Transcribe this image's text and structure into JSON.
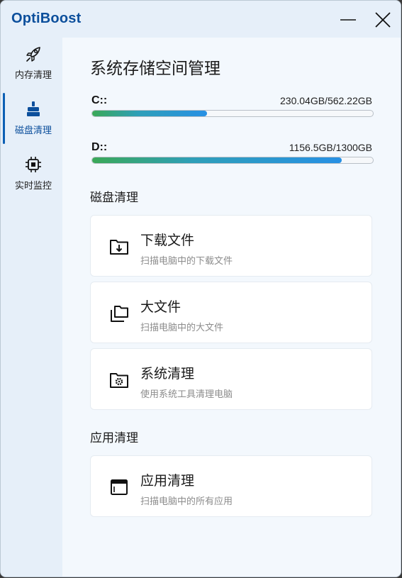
{
  "app": {
    "title": "OptiBoost"
  },
  "window_controls": {
    "minimize_icon": "minimize-icon",
    "close_icon": "close-icon"
  },
  "sidebar": {
    "items": [
      {
        "label": "内存清理",
        "icon": "rocket-icon",
        "active": false
      },
      {
        "label": "磁盘清理",
        "icon": "broom-icon",
        "active": true
      },
      {
        "label": "实时监控",
        "icon": "chip-icon",
        "active": false
      }
    ]
  },
  "main": {
    "title": "系统存储空间管理",
    "disks": [
      {
        "name": "C::",
        "usage": "230.04GB/562.22GB",
        "used_fraction": 0.4092
      },
      {
        "name": "D::",
        "usage": "1156.5GB/1300GB",
        "used_fraction": 0.8896
      }
    ],
    "disk_section": {
      "title": "磁盘清理",
      "cards": [
        {
          "title": "下载文件",
          "desc": "扫描电脑中的下载文件",
          "icon": "download-folder-icon"
        },
        {
          "title": "大文件",
          "desc": "扫描电脑中的大文件",
          "icon": "copy-files-icon"
        },
        {
          "title": "系统清理",
          "desc": "使用系统工具清理电脑",
          "icon": "settings-folder-icon"
        }
      ]
    },
    "app_section": {
      "title": "应用清理",
      "cards": [
        {
          "title": "应用清理",
          "desc": "扫描电脑中的所有应用",
          "icon": "app-window-icon"
        }
      ]
    }
  },
  "colors": {
    "brand": "#0c4f9c",
    "sidebar_bg": "#e6eff9",
    "content_bg": "#f3f8fd",
    "bar_green": "#3aa857",
    "bar_blue": "#2790e4"
  }
}
